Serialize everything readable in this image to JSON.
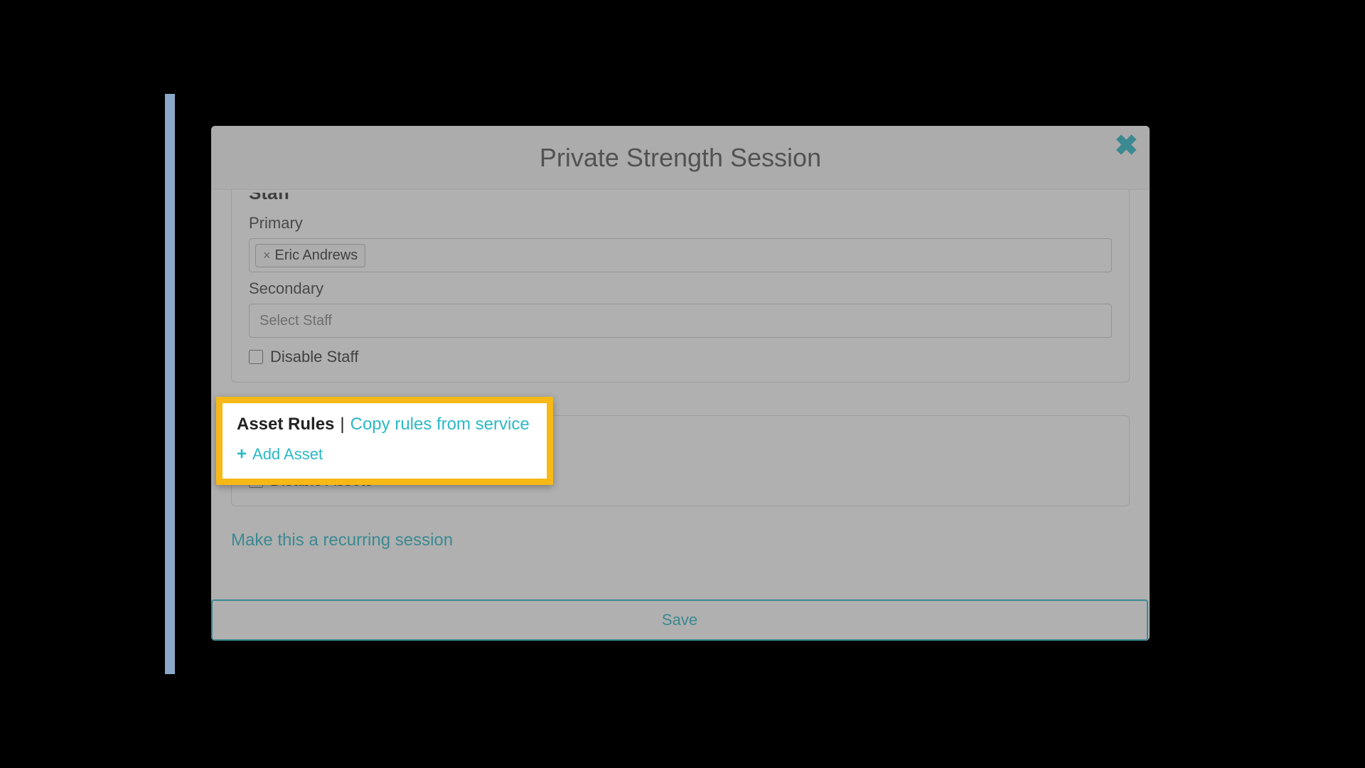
{
  "modal": {
    "title": "Private Strength Session",
    "close_icon": "✖"
  },
  "staff": {
    "section_title": "Staff",
    "primary_label": "Primary",
    "primary_tag": "Eric Andrews",
    "secondary_label": "Secondary",
    "secondary_placeholder": "Select Staff",
    "disable_label": "Disable Staff"
  },
  "assets": {
    "section_title": "Asset Rules",
    "separator": "|",
    "copy_link": "Copy rules from service",
    "add_label": "Add Asset",
    "disable_label": "Disable Assets"
  },
  "recurring_link": "Make this a recurring session",
  "save_label": "Save",
  "highlight": {
    "title": "Asset Rules",
    "separator": "|",
    "copy_link": "Copy rules from service",
    "add_label": "Add Asset"
  }
}
